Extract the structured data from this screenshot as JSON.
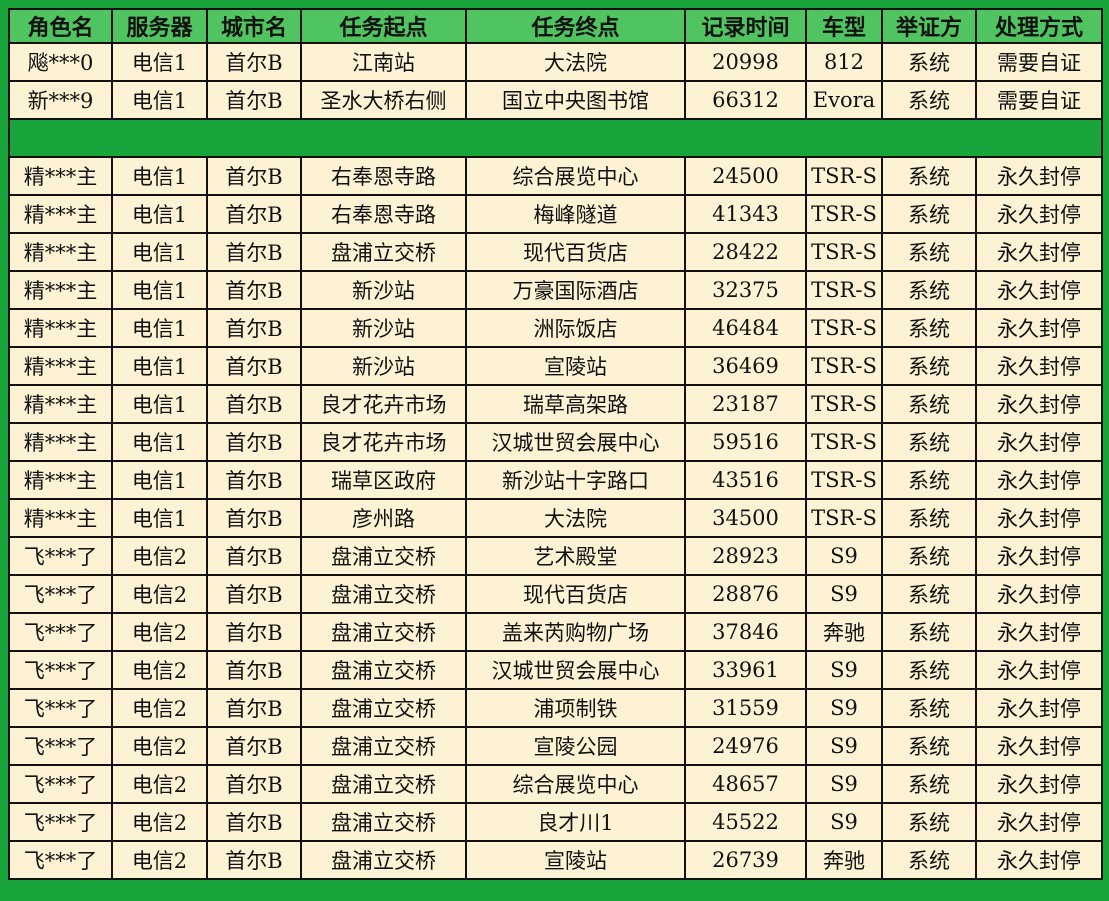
{
  "colors": {
    "frame": "#1aa53c",
    "header_bg": "#4fc460",
    "cell_bg": "#fdf3d4",
    "border": "#111111"
  },
  "headers": [
    "角色名",
    "服务器",
    "城市名",
    "任务起点",
    "任务终点",
    "记录时间",
    "车型",
    "举证方",
    "处理方式"
  ],
  "top_rows": [
    [
      "飚***0",
      "电信1",
      "首尔B",
      "江南站",
      "大法院",
      "20998",
      "812",
      "系统",
      "需要自证"
    ],
    [
      "新***9",
      "电信1",
      "首尔B",
      "圣水大桥右侧",
      "国立中央图书馆",
      "66312",
      "Evora",
      "系统",
      "需要自证"
    ]
  ],
  "bottom_rows": [
    [
      "精***主",
      "电信1",
      "首尔B",
      "右奉恩寺路",
      "综合展览中心",
      "24500",
      "TSR-S",
      "系统",
      "永久封停"
    ],
    [
      "精***主",
      "电信1",
      "首尔B",
      "右奉恩寺路",
      "梅峰隧道",
      "41343",
      "TSR-S",
      "系统",
      "永久封停"
    ],
    [
      "精***主",
      "电信1",
      "首尔B",
      "盘浦立交桥",
      "现代百货店",
      "28422",
      "TSR-S",
      "系统",
      "永久封停"
    ],
    [
      "精***主",
      "电信1",
      "首尔B",
      "新沙站",
      "万豪国际酒店",
      "32375",
      "TSR-S",
      "系统",
      "永久封停"
    ],
    [
      "精***主",
      "电信1",
      "首尔B",
      "新沙站",
      "洲际饭店",
      "46484",
      "TSR-S",
      "系统",
      "永久封停"
    ],
    [
      "精***主",
      "电信1",
      "首尔B",
      "新沙站",
      "宣陵站",
      "36469",
      "TSR-S",
      "系统",
      "永久封停"
    ],
    [
      "精***主",
      "电信1",
      "首尔B",
      "良才花卉市场",
      "瑞草高架路",
      "23187",
      "TSR-S",
      "系统",
      "永久封停"
    ],
    [
      "精***主",
      "电信1",
      "首尔B",
      "良才花卉市场",
      "汉城世贸会展中心",
      "59516",
      "TSR-S",
      "系统",
      "永久封停"
    ],
    [
      "精***主",
      "电信1",
      "首尔B",
      "瑞草区政府",
      "新沙站十字路口",
      "43516",
      "TSR-S",
      "系统",
      "永久封停"
    ],
    [
      "精***主",
      "电信1",
      "首尔B",
      "彦州路",
      "大法院",
      "34500",
      "TSR-S",
      "系统",
      "永久封停"
    ],
    [
      "飞***了",
      "电信2",
      "首尔B",
      "盘浦立交桥",
      "艺术殿堂",
      "28923",
      "S9",
      "系统",
      "永久封停"
    ],
    [
      "飞***了",
      "电信2",
      "首尔B",
      "盘浦立交桥",
      "现代百货店",
      "28876",
      "S9",
      "系统",
      "永久封停"
    ],
    [
      "飞***了",
      "电信2",
      "首尔B",
      "盘浦立交桥",
      "盖来芮购物广场",
      "37846",
      "奔驰",
      "系统",
      "永久封停"
    ],
    [
      "飞***了",
      "电信2",
      "首尔B",
      "盘浦立交桥",
      "汉城世贸会展中心",
      "33961",
      "S9",
      "系统",
      "永久封停"
    ],
    [
      "飞***了",
      "电信2",
      "首尔B",
      "盘浦立交桥",
      "浦项制铁",
      "31559",
      "S9",
      "系统",
      "永久封停"
    ],
    [
      "飞***了",
      "电信2",
      "首尔B",
      "盘浦立交桥",
      "宣陵公园",
      "24976",
      "S9",
      "系统",
      "永久封停"
    ],
    [
      "飞***了",
      "电信2",
      "首尔B",
      "盘浦立交桥",
      "综合展览中心",
      "48657",
      "S9",
      "系统",
      "永久封停"
    ],
    [
      "飞***了",
      "电信2",
      "首尔B",
      "盘浦立交桥",
      "良才川1",
      "45522",
      "S9",
      "系统",
      "永久封停"
    ],
    [
      "飞***了",
      "电信2",
      "首尔B",
      "盘浦立交桥",
      "宣陵站",
      "26739",
      "奔驰",
      "系统",
      "永久封停"
    ]
  ]
}
